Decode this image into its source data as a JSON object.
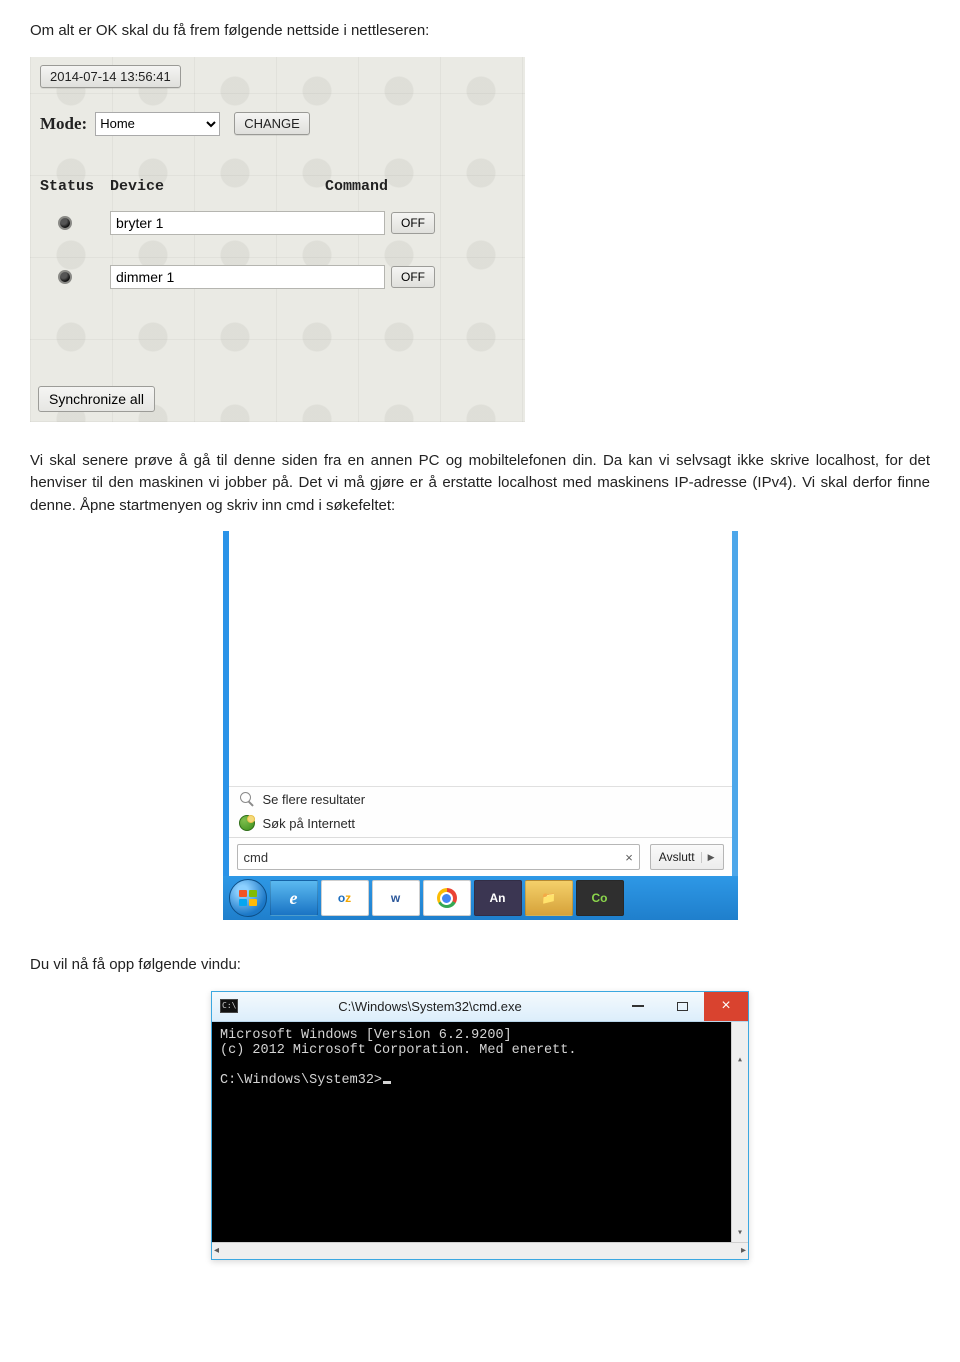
{
  "doc": {
    "p1": "Om alt er OK skal du få frem følgende nettside i nettleseren:",
    "p2": "Vi skal senere prøve å gå til denne siden fra en annen PC og mobiltelefonen din. Da kan vi selvsagt ikke skrive localhost, for det henviser til den maskinen vi jobber på. Det vi må gjøre er å erstatte localhost med maskinens IP-adresse (IPv4). Vi skal derfor finne denne. Åpne startmenyen og skriv inn cmd i søkefeltet:",
    "p3": "Du vil nå få opp følgende vindu:"
  },
  "shot1": {
    "timestamp": "2014-07-14 13:56:41",
    "mode_label": "Mode:",
    "mode_value": "Home",
    "change_label": "CHANGE",
    "headers": {
      "status": "Status",
      "device": "Device",
      "command": "Command"
    },
    "rows": [
      {
        "name": "bryter 1",
        "cmd": "OFF"
      },
      {
        "name": "dimmer 1",
        "cmd": "OFF"
      }
    ],
    "sync_label": "Synchronize all"
  },
  "shot2": {
    "results": {
      "more": "Se flere resultater",
      "internet": "Søk på Internett"
    },
    "search_value": "cmd",
    "shutdown_label": "Avslutt",
    "taskbar": [
      "start-orb",
      "ie",
      "outlook",
      "word",
      "chrome",
      "animate",
      "explorer",
      "co"
    ]
  },
  "shot3": {
    "title": "C:\\Windows\\System32\\cmd.exe",
    "line1": "Microsoft Windows [Version 6.2.9200]",
    "line2": "(c) 2012 Microsoft Corporation. Med enerett.",
    "prompt": "C:\\Windows\\System32>"
  }
}
